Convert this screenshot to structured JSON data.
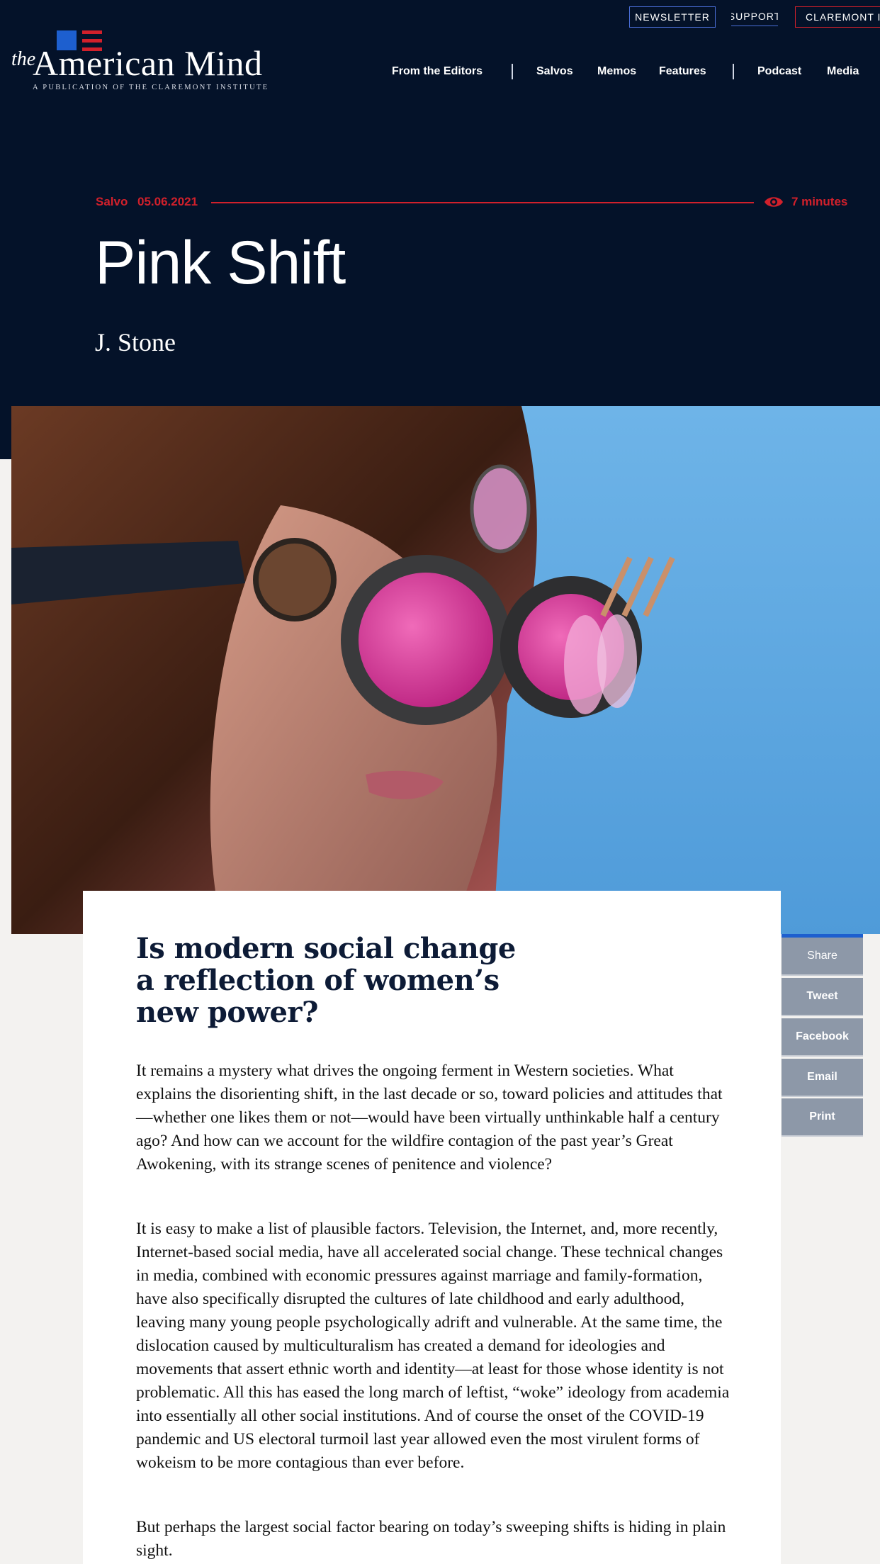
{
  "utility": {
    "newsletter": "NEWSLETTER",
    "support": "SUPPORT",
    "claremont": "CLAREMONT IN"
  },
  "logo": {
    "the": "the",
    "name": "American Mind",
    "tagline": "A PUBLICATION OF THE CLAREMONT INSTITUTE"
  },
  "nav": {
    "from_editors": "From the Editors",
    "salvos": "Salvos",
    "memos": "Memos",
    "features": "Features",
    "podcast": "Podcast",
    "media": "Media"
  },
  "article": {
    "category": "Salvo",
    "date": "05.06.2021",
    "read_time": "7 minutes",
    "title": "Pink Shift",
    "author": "J. Stone",
    "deck": "Is modern social change a reflection of women’s new power?",
    "paragraphs": [
      "It remains a mystery what drives the ongoing ferment in Western societies. What explains the disorienting shift, in the last decade or so, toward policies and attitudes that—whether one likes them or not—would have been virtually unthinkable half a century ago? And how can we account for the wildfire contagion of the past year’s Great Awokening, with its strange scenes of penitence and violence?",
      "It is easy to make a list of plausible factors. Television, the Internet, and, more recently, Internet-based social media, have all accelerated social change. These technical changes in media, combined with economic pressures against marriage and family-formation, have also specifically disrupted the cultures of late childhood and early adulthood, leaving many young people psychologically adrift and vulnerable. At the same time, the dislocation caused by multiculturalism has created a demand for ideologies and movements that assert ethnic worth and identity—at least for those whose identity is not problematic. All this has eased the long march of leftist, “woke” ideology from academia into essentially all other social institutions. And of course the onset of the COVID-19 pandemic and US electoral turmoil last year allowed even the most virulent forms of wokeism to be more contagious than ever before.",
      "But perhaps the largest social factor bearing on today’s sweeping shifts is hiding in plain sight."
    ]
  },
  "share": {
    "share": "Share",
    "tweet": "Tweet",
    "facebook": "Facebook",
    "email": "Email",
    "print": "Print"
  },
  "colors": {
    "header_bg": "#041229",
    "accent_red": "#d1202b",
    "accent_blue": "#1d5fcf",
    "share_gray": "#8d98a8",
    "lens_pink": "#d6369c",
    "sky_blue": "#5fa8e0"
  },
  "icons": {
    "read_time": "eye-icon"
  }
}
